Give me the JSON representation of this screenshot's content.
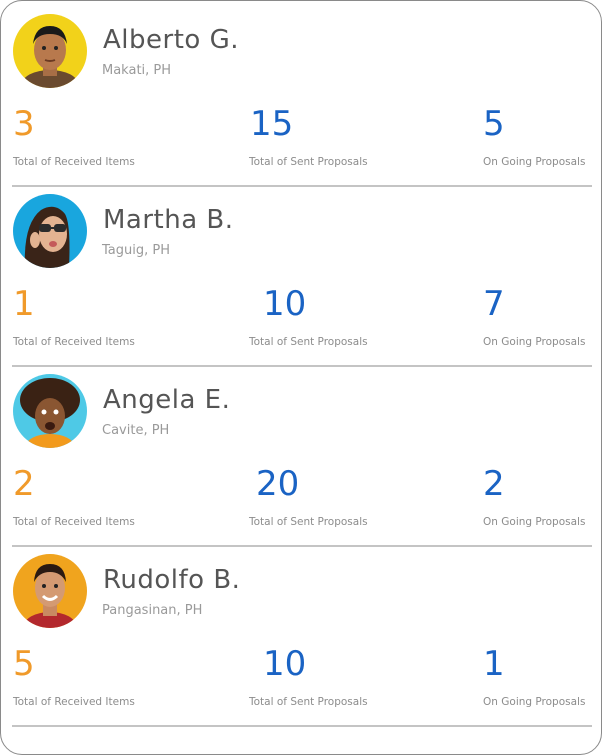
{
  "users": [
    {
      "name": "Alberto G.",
      "location": "Makati, PH",
      "received": "3",
      "sent": "15",
      "ongoing": "5",
      "label_received": "Total of Received Items",
      "label_sent": "Total of Sent Proposals",
      "label_ongoing": "On Going Proposals",
      "avatar_bg": "#f2d21a"
    },
    {
      "name": "Martha B.",
      "location": "Taguig, PH",
      "received": "1",
      "sent": "10",
      "ongoing": "7",
      "label_received": "Total of Received Items",
      "label_sent": "Total of Sent Proposals",
      "label_ongoing": "On Going Proposals",
      "avatar_bg": "#19a6de"
    },
    {
      "name": "Angela E.",
      "location": "Cavite, PH",
      "received": "2",
      "sent": "20",
      "ongoing": "2",
      "label_received": "Total of Received Items",
      "label_sent": "Total of Sent Proposals",
      "label_ongoing": "On Going Proposals",
      "avatar_bg": "#4ec9e6"
    },
    {
      "name": "Rudolfo B.",
      "location": "Pangasinan, PH",
      "received": "5",
      "sent": "10",
      "ongoing": "1",
      "label_received": "Total of Received Items",
      "label_sent": "Total of Sent Proposals",
      "label_ongoing": "On Going Proposals",
      "avatar_bg": "#f0a41e"
    }
  ],
  "colors": {
    "received": "#f09a2a",
    "sent": "#1a63c4",
    "ongoing": "#1a63c4"
  }
}
